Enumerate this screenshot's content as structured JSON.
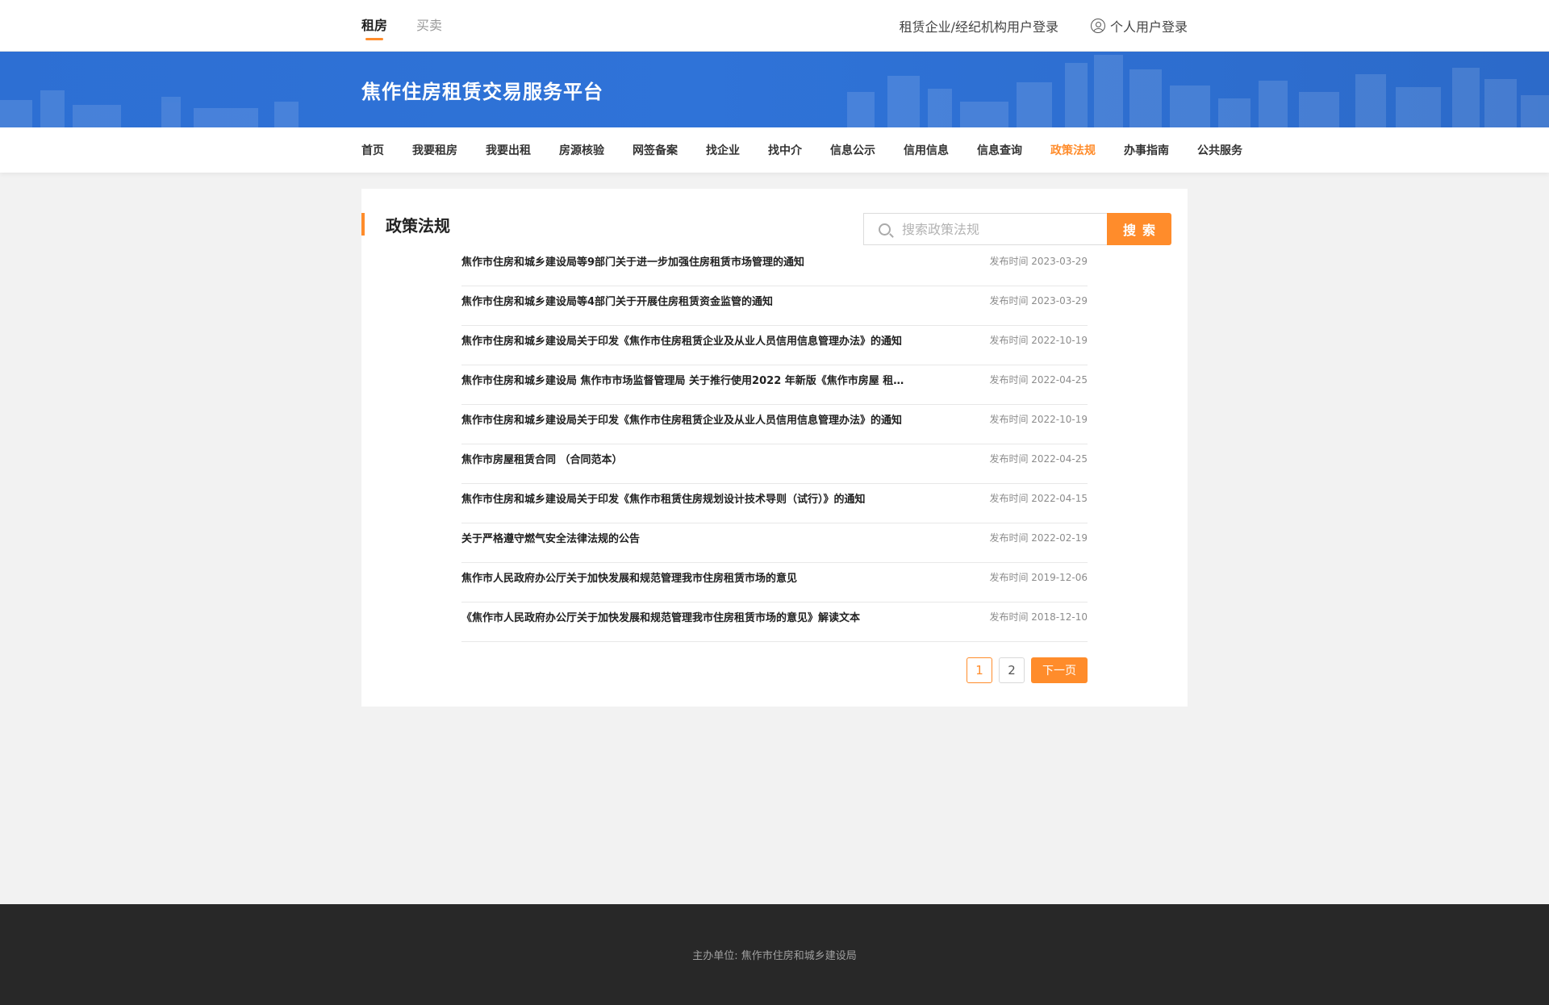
{
  "top_tabs": [
    {
      "label": "租房",
      "active": true
    },
    {
      "label": "买卖",
      "active": false
    }
  ],
  "top_logins": {
    "company": "租赁企业/经纪机构用户登录",
    "personal": "个人用户登录",
    "personal_icon": "user-circle-icon"
  },
  "site_title": "焦作住房租赁交易服务平台",
  "nav": [
    {
      "label": "首页",
      "active": false
    },
    {
      "label": "我要租房",
      "active": false
    },
    {
      "label": "我要出租",
      "active": false
    },
    {
      "label": "房源核验",
      "active": false
    },
    {
      "label": "网签备案",
      "active": false
    },
    {
      "label": "找企业",
      "active": false
    },
    {
      "label": "找中介",
      "active": false
    },
    {
      "label": "信息公示",
      "active": false
    },
    {
      "label": "信用信息",
      "active": false
    },
    {
      "label": "信息查询",
      "active": false
    },
    {
      "label": "政策法规",
      "active": true
    },
    {
      "label": "办事指南",
      "active": false
    },
    {
      "label": "公共服务",
      "active": false
    }
  ],
  "section": {
    "title": "政策法规",
    "search_placeholder": "搜索政策法规",
    "search_button": "搜索",
    "search_icon": "search-icon"
  },
  "articles": [
    {
      "title": "焦作市住房和城乡建设局等9部门关于进一步加强住房租赁市场管理的通知",
      "date": "发布时间 2023-03-29"
    },
    {
      "title": "焦作市住房和城乡建设局等4部门关于开展住房租赁资金监管的通知",
      "date": "发布时间 2023-03-29"
    },
    {
      "title": "焦作市住房和城乡建设局关于印发《焦作市住房租赁企业及从业人员信用信息管理办法》的通知",
      "date": "发布时间 2022-10-19"
    },
    {
      "title": "焦作市住房和城乡建设局 焦作市市场监督管理局 关于推行使用2022 年新版《焦作市房屋 租…",
      "date": "发布时间 2022-04-25"
    },
    {
      "title": "焦作市住房和城乡建设局关于印发《焦作市住房租赁企业及从业人员信用信息管理办法》的通知",
      "date": "发布时间 2022-10-19"
    },
    {
      "title": "焦作市房屋租赁合同 （合同范本）",
      "date": "发布时间 2022-04-25"
    },
    {
      "title": "焦作市住房和城乡建设局关于印发《焦作市租赁住房规划设计技术导则（试行）》的通知",
      "date": "发布时间 2022-04-15"
    },
    {
      "title": "关于严格遵守燃气安全法律法规的公告",
      "date": "发布时间 2022-02-19"
    },
    {
      "title": "焦作市人民政府办公厅关于加快发展和规范管理我市住房租赁市场的意见",
      "date": "发布时间 2019-12-06"
    },
    {
      "title": "《焦作市人民政府办公厅关于加快发展和规范管理我市住房租赁市场的意见》解读文本",
      "date": "发布时间 2018-12-10"
    }
  ],
  "pagination": {
    "pages": [
      "1",
      "2"
    ],
    "current": "1",
    "next_label": "下一页"
  },
  "footer": {
    "text": "主办单位:   焦作市住房和城乡建设局"
  },
  "colors": {
    "accent": "#ff8c2b",
    "banner": "#2f73d8",
    "footer_bg": "#282828"
  }
}
